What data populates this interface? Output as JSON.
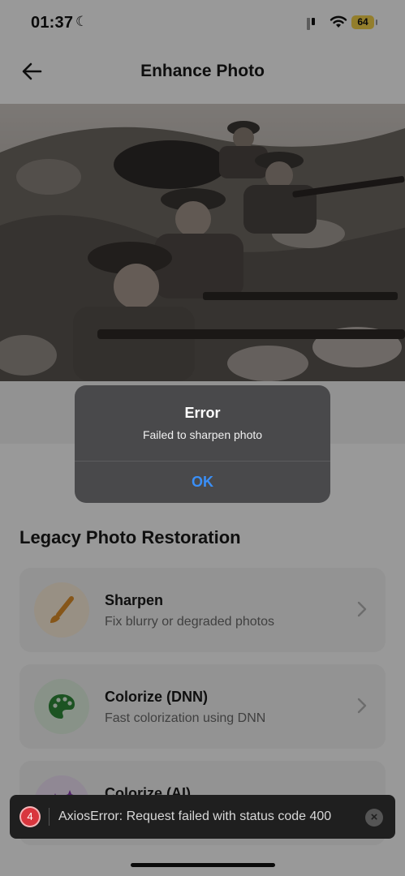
{
  "status_bar": {
    "time": "01:37",
    "battery": "64"
  },
  "header": {
    "title": "Enhance Photo",
    "back_icon": "arrow-left-icon"
  },
  "section": {
    "title": "Legacy Photo Restoration"
  },
  "options": [
    {
      "name": "Sharpen",
      "desc": "Fix blurry or degraded photos",
      "icon": "brush-icon",
      "icon_color": "#e0902a",
      "icon_bg": "#fdf0dd"
    },
    {
      "name": "Colorize (DNN)",
      "desc": "Fast colorization using DNN",
      "icon": "palette-icon",
      "icon_color": "#2f8a3a",
      "icon_bg": "#e3f3e3"
    },
    {
      "name": "Colorize (AI)",
      "icon": "sparkles-icon",
      "icon_color": "#8b3fb5",
      "icon_bg": "#f1e3f7"
    }
  ],
  "alert": {
    "title": "Error",
    "message": "Failed to sharpen photo",
    "ok_label": "OK"
  },
  "toast": {
    "count": "4",
    "message": "AxiosError: Request failed with status code 400"
  },
  "colors": {
    "accent": "#3a8ff7",
    "error": "#d9363e"
  }
}
